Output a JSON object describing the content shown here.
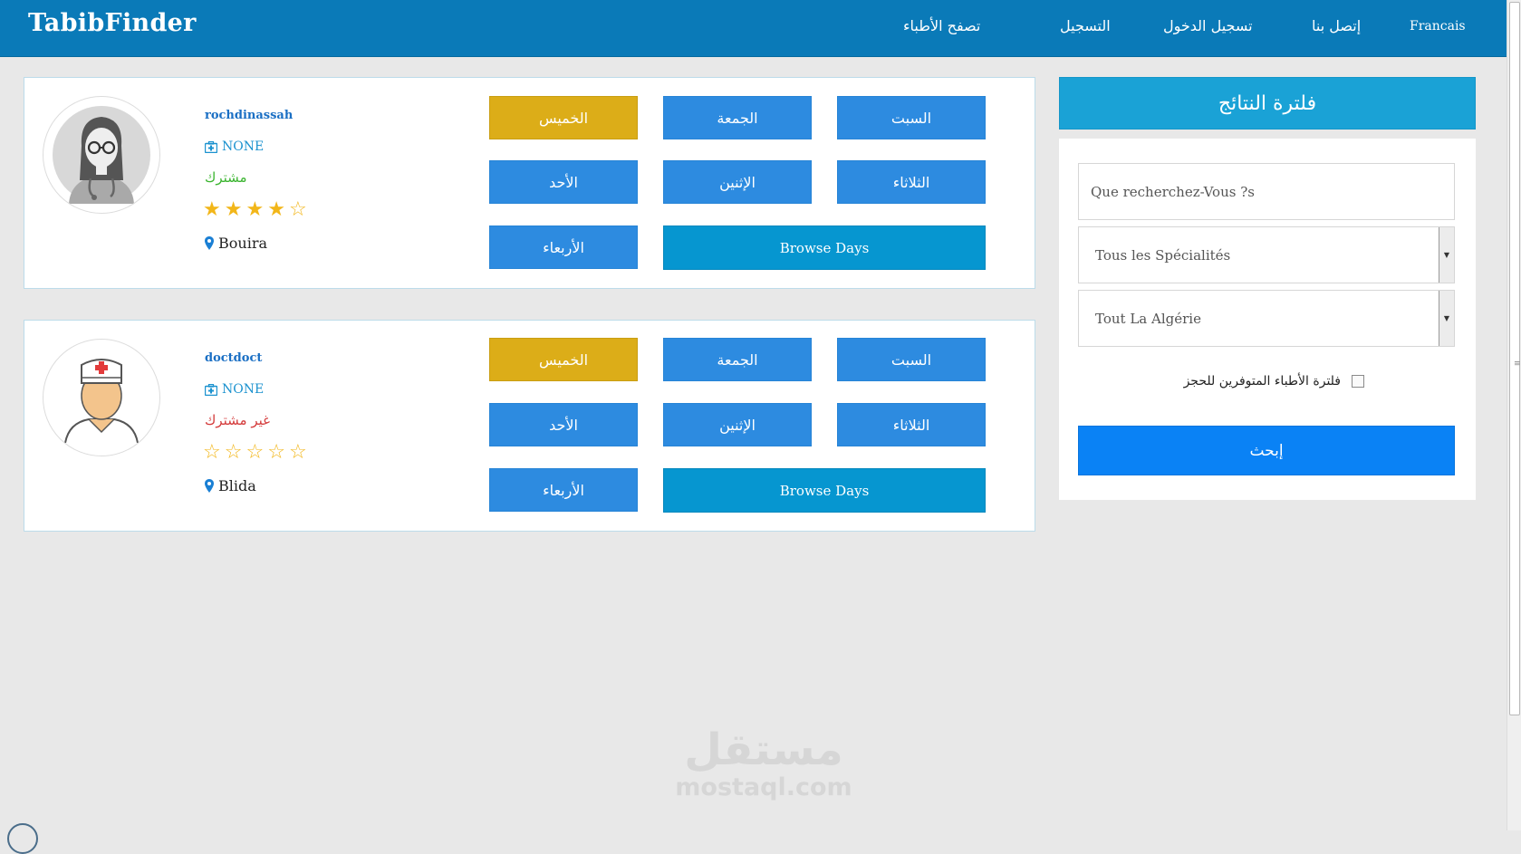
{
  "nav": {
    "brand": "TabibFinder",
    "links": [
      "تصفح الأطباء",
      "التسجيل",
      "تسجيل الدخول",
      "إتصل بنا",
      "Francais"
    ]
  },
  "doctors": [
    {
      "name": "rochdinassah",
      "speciality": "NONE",
      "status": "مشترك",
      "status_color": "#3cb531",
      "rating": 4,
      "rating_max": 5,
      "location": "Bouira",
      "days": {
        "thursday": "الخميس",
        "friday": "الجمعة",
        "saturday": "السبت",
        "sunday": "الأحد",
        "monday": "الإثنين",
        "tuesday": "الثلاثاء",
        "wednesday": "الأربعاء"
      },
      "browse_label": "Browse Days"
    },
    {
      "name": "doctdoct",
      "speciality": "NONE",
      "status": "غير مشترك",
      "status_color": "#d43b3b",
      "rating": 0,
      "rating_max": 5,
      "location": "Blida",
      "days": {
        "thursday": "الخميس",
        "friday": "الجمعة",
        "saturday": "السبت",
        "sunday": "الأحد",
        "monday": "الإثنين",
        "tuesday": "الثلاثاء",
        "wednesday": "الأربعاء"
      },
      "browse_label": "Browse Days"
    }
  ],
  "filter": {
    "title": "فلترة النتائج",
    "search_placeholder": "Que recherchez-Vous ?s",
    "speciality_selected": "Tous les Spécialités",
    "region_selected": "Tout La Algérie",
    "available_label": "فلترة الأطباء المتوفرين للحجز",
    "available_checked": false,
    "search_button": "إبحث"
  },
  "colors": {
    "navbar": "#0a7ab8",
    "day_button": "#2d8be0",
    "today_button": "#dcad18",
    "browse_button": "#0696d0",
    "filter_header": "#1aa2d6",
    "search_button": "#0a82f5"
  },
  "watermark": {
    "arabic": "مستقل",
    "latin": "mostaql.com"
  }
}
